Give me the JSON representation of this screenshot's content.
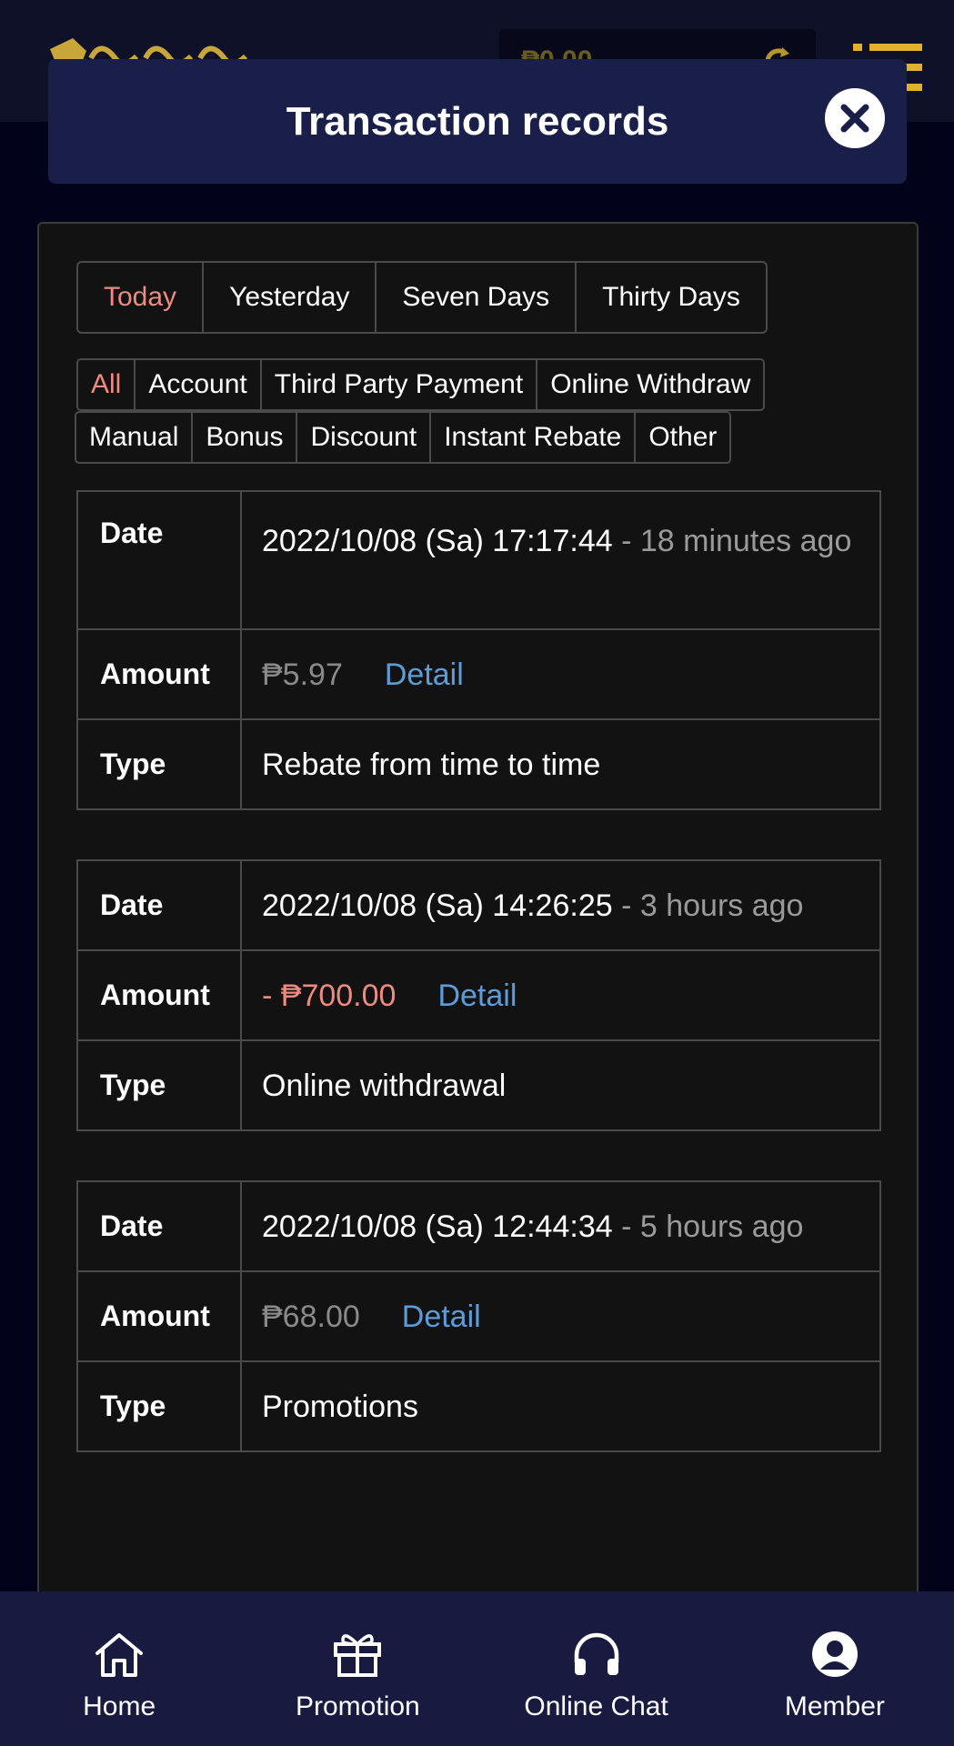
{
  "header": {
    "balance": "₱0.00"
  },
  "modal": {
    "title": "Transaction records"
  },
  "period_tabs": [
    {
      "label": "Today",
      "active": true
    },
    {
      "label": "Yesterday",
      "active": false
    },
    {
      "label": "Seven Days",
      "active": false
    },
    {
      "label": "Thirty Days",
      "active": false
    }
  ],
  "type_tabs": [
    {
      "label": "All",
      "active": true
    },
    {
      "label": "Account",
      "active": false
    },
    {
      "label": "Third Party Payment",
      "active": false
    },
    {
      "label": "Online Withdraw",
      "active": false
    },
    {
      "label": "Manual",
      "active": false
    },
    {
      "label": "Bonus",
      "active": false
    },
    {
      "label": "Discount",
      "active": false
    },
    {
      "label": "Instant Rebate",
      "active": false
    },
    {
      "label": "Other",
      "active": false
    }
  ],
  "labels": {
    "date": "Date",
    "amount": "Amount",
    "type": "Type",
    "detail": "Detail"
  },
  "records": [
    {
      "date": "2022/10/08 (Sa) 17:17:44",
      "relative": "- 18 minutes ago",
      "amount": "₱5.97",
      "type": "Rebate from time to time"
    },
    {
      "date": "2022/10/08 (Sa) 14:26:25",
      "relative": "- 3 hours ago",
      "amount": "- ₱700.00",
      "type": "Online withdrawal"
    },
    {
      "date": "2022/10/08 (Sa) 12:44:34",
      "relative": "- 5 hours ago",
      "amount": "₱68.00",
      "type": "Promotions"
    }
  ],
  "bottom_nav": [
    {
      "label": "Home",
      "icon": "home-icon"
    },
    {
      "label": "Promotion",
      "icon": "gift-icon"
    },
    {
      "label": "Online Chat",
      "icon": "headphones-icon"
    },
    {
      "label": "Member",
      "icon": "user-icon"
    }
  ],
  "colors": {
    "active_tab": "#ef8a80",
    "detail_link": "#5e9cd9",
    "modal_header": "#1a1f4a",
    "nav_bg": "#181a40"
  }
}
